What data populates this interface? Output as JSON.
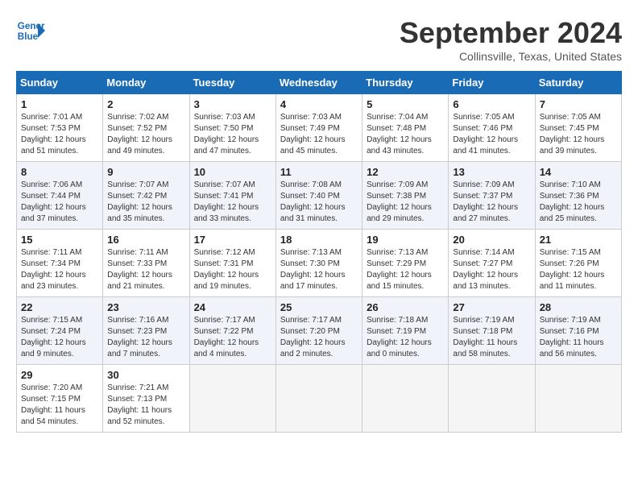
{
  "header": {
    "logo_line1": "General",
    "logo_line2": "Blue",
    "month": "September 2024",
    "location": "Collinsville, Texas, United States"
  },
  "weekdays": [
    "Sunday",
    "Monday",
    "Tuesday",
    "Wednesday",
    "Thursday",
    "Friday",
    "Saturday"
  ],
  "weeks": [
    [
      {
        "day": "1",
        "sunrise": "Sunrise: 7:01 AM",
        "sunset": "Sunset: 7:53 PM",
        "daylight": "Daylight: 12 hours and 51 minutes."
      },
      {
        "day": "2",
        "sunrise": "Sunrise: 7:02 AM",
        "sunset": "Sunset: 7:52 PM",
        "daylight": "Daylight: 12 hours and 49 minutes."
      },
      {
        "day": "3",
        "sunrise": "Sunrise: 7:03 AM",
        "sunset": "Sunset: 7:50 PM",
        "daylight": "Daylight: 12 hours and 47 minutes."
      },
      {
        "day": "4",
        "sunrise": "Sunrise: 7:03 AM",
        "sunset": "Sunset: 7:49 PM",
        "daylight": "Daylight: 12 hours and 45 minutes."
      },
      {
        "day": "5",
        "sunrise": "Sunrise: 7:04 AM",
        "sunset": "Sunset: 7:48 PM",
        "daylight": "Daylight: 12 hours and 43 minutes."
      },
      {
        "day": "6",
        "sunrise": "Sunrise: 7:05 AM",
        "sunset": "Sunset: 7:46 PM",
        "daylight": "Daylight: 12 hours and 41 minutes."
      },
      {
        "day": "7",
        "sunrise": "Sunrise: 7:05 AM",
        "sunset": "Sunset: 7:45 PM",
        "daylight": "Daylight: 12 hours and 39 minutes."
      }
    ],
    [
      {
        "day": "8",
        "sunrise": "Sunrise: 7:06 AM",
        "sunset": "Sunset: 7:44 PM",
        "daylight": "Daylight: 12 hours and 37 minutes."
      },
      {
        "day": "9",
        "sunrise": "Sunrise: 7:07 AM",
        "sunset": "Sunset: 7:42 PM",
        "daylight": "Daylight: 12 hours and 35 minutes."
      },
      {
        "day": "10",
        "sunrise": "Sunrise: 7:07 AM",
        "sunset": "Sunset: 7:41 PM",
        "daylight": "Daylight: 12 hours and 33 minutes."
      },
      {
        "day": "11",
        "sunrise": "Sunrise: 7:08 AM",
        "sunset": "Sunset: 7:40 PM",
        "daylight": "Daylight: 12 hours and 31 minutes."
      },
      {
        "day": "12",
        "sunrise": "Sunrise: 7:09 AM",
        "sunset": "Sunset: 7:38 PM",
        "daylight": "Daylight: 12 hours and 29 minutes."
      },
      {
        "day": "13",
        "sunrise": "Sunrise: 7:09 AM",
        "sunset": "Sunset: 7:37 PM",
        "daylight": "Daylight: 12 hours and 27 minutes."
      },
      {
        "day": "14",
        "sunrise": "Sunrise: 7:10 AM",
        "sunset": "Sunset: 7:36 PM",
        "daylight": "Daylight: 12 hours and 25 minutes."
      }
    ],
    [
      {
        "day": "15",
        "sunrise": "Sunrise: 7:11 AM",
        "sunset": "Sunset: 7:34 PM",
        "daylight": "Daylight: 12 hours and 23 minutes."
      },
      {
        "day": "16",
        "sunrise": "Sunrise: 7:11 AM",
        "sunset": "Sunset: 7:33 PM",
        "daylight": "Daylight: 12 hours and 21 minutes."
      },
      {
        "day": "17",
        "sunrise": "Sunrise: 7:12 AM",
        "sunset": "Sunset: 7:31 PM",
        "daylight": "Daylight: 12 hours and 19 minutes."
      },
      {
        "day": "18",
        "sunrise": "Sunrise: 7:13 AM",
        "sunset": "Sunset: 7:30 PM",
        "daylight": "Daylight: 12 hours and 17 minutes."
      },
      {
        "day": "19",
        "sunrise": "Sunrise: 7:13 AM",
        "sunset": "Sunset: 7:29 PM",
        "daylight": "Daylight: 12 hours and 15 minutes."
      },
      {
        "day": "20",
        "sunrise": "Sunrise: 7:14 AM",
        "sunset": "Sunset: 7:27 PM",
        "daylight": "Daylight: 12 hours and 13 minutes."
      },
      {
        "day": "21",
        "sunrise": "Sunrise: 7:15 AM",
        "sunset": "Sunset: 7:26 PM",
        "daylight": "Daylight: 12 hours and 11 minutes."
      }
    ],
    [
      {
        "day": "22",
        "sunrise": "Sunrise: 7:15 AM",
        "sunset": "Sunset: 7:24 PM",
        "daylight": "Daylight: 12 hours and 9 minutes."
      },
      {
        "day": "23",
        "sunrise": "Sunrise: 7:16 AM",
        "sunset": "Sunset: 7:23 PM",
        "daylight": "Daylight: 12 hours and 7 minutes."
      },
      {
        "day": "24",
        "sunrise": "Sunrise: 7:17 AM",
        "sunset": "Sunset: 7:22 PM",
        "daylight": "Daylight: 12 hours and 4 minutes."
      },
      {
        "day": "25",
        "sunrise": "Sunrise: 7:17 AM",
        "sunset": "Sunset: 7:20 PM",
        "daylight": "Daylight: 12 hours and 2 minutes."
      },
      {
        "day": "26",
        "sunrise": "Sunrise: 7:18 AM",
        "sunset": "Sunset: 7:19 PM",
        "daylight": "Daylight: 12 hours and 0 minutes."
      },
      {
        "day": "27",
        "sunrise": "Sunrise: 7:19 AM",
        "sunset": "Sunset: 7:18 PM",
        "daylight": "Daylight: 11 hours and 58 minutes."
      },
      {
        "day": "28",
        "sunrise": "Sunrise: 7:19 AM",
        "sunset": "Sunset: 7:16 PM",
        "daylight": "Daylight: 11 hours and 56 minutes."
      }
    ],
    [
      {
        "day": "29",
        "sunrise": "Sunrise: 7:20 AM",
        "sunset": "Sunset: 7:15 PM",
        "daylight": "Daylight: 11 hours and 54 minutes."
      },
      {
        "day": "30",
        "sunrise": "Sunrise: 7:21 AM",
        "sunset": "Sunset: 7:13 PM",
        "daylight": "Daylight: 11 hours and 52 minutes."
      },
      null,
      null,
      null,
      null,
      null
    ]
  ]
}
